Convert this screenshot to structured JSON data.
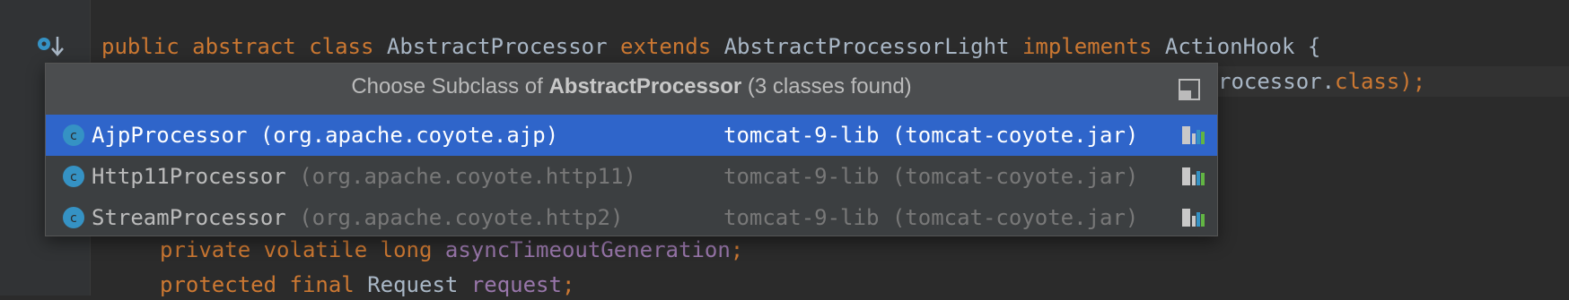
{
  "editor": {
    "line1": {
      "kw1": "public",
      "kw2": "abstract",
      "kw3": "class",
      "name": "AbstractProcessor",
      "kw4": "extends",
      "parent": "AbstractProcessorLight",
      "kw5": "implements",
      "iface": "ActionHook {"
    },
    "line2": {
      "partial": "rocessor.",
      "kw": "class",
      "end": ");"
    },
    "line3": {
      "kw1": "private",
      "kw2": "volatile",
      "kw3": "long",
      "field": "asyncTimeoutGeneration",
      "end": ";"
    },
    "line4": {
      "kw1": "protected",
      "kw2": "final",
      "type": "Request",
      "field": "request",
      "end": ";"
    }
  },
  "popup": {
    "title_prefix": "Choose Subclass of ",
    "title_class": "AbstractProcessor",
    "title_suffix": " (3 classes found)",
    "items": [
      {
        "name": "AjpProcessor",
        "package": "(org.apache.coyote.ajp)",
        "library": "tomcat-9-lib (tomcat-coyote.jar)",
        "selected": true
      },
      {
        "name": "Http11Processor",
        "package": "(org.apache.coyote.http11)",
        "library": "tomcat-9-lib (tomcat-coyote.jar)",
        "selected": false
      },
      {
        "name": "StreamProcessor",
        "package": "(org.apache.coyote.http2)",
        "library": "tomcat-9-lib (tomcat-coyote.jar)",
        "selected": false
      }
    ]
  },
  "icons": {
    "gutter": "overridden-methods-icon",
    "class": "class-icon",
    "library": "library-icon",
    "pin": "pin-window-icon"
  },
  "colors": {
    "editor_bg": "#2b2b2b",
    "keyword": "#cc7832",
    "field": "#9876aa",
    "text": "#a9b7c6",
    "selection": "#2f65ca",
    "popup_bg": "#3c3f41",
    "class_icon": "#3592c4"
  }
}
